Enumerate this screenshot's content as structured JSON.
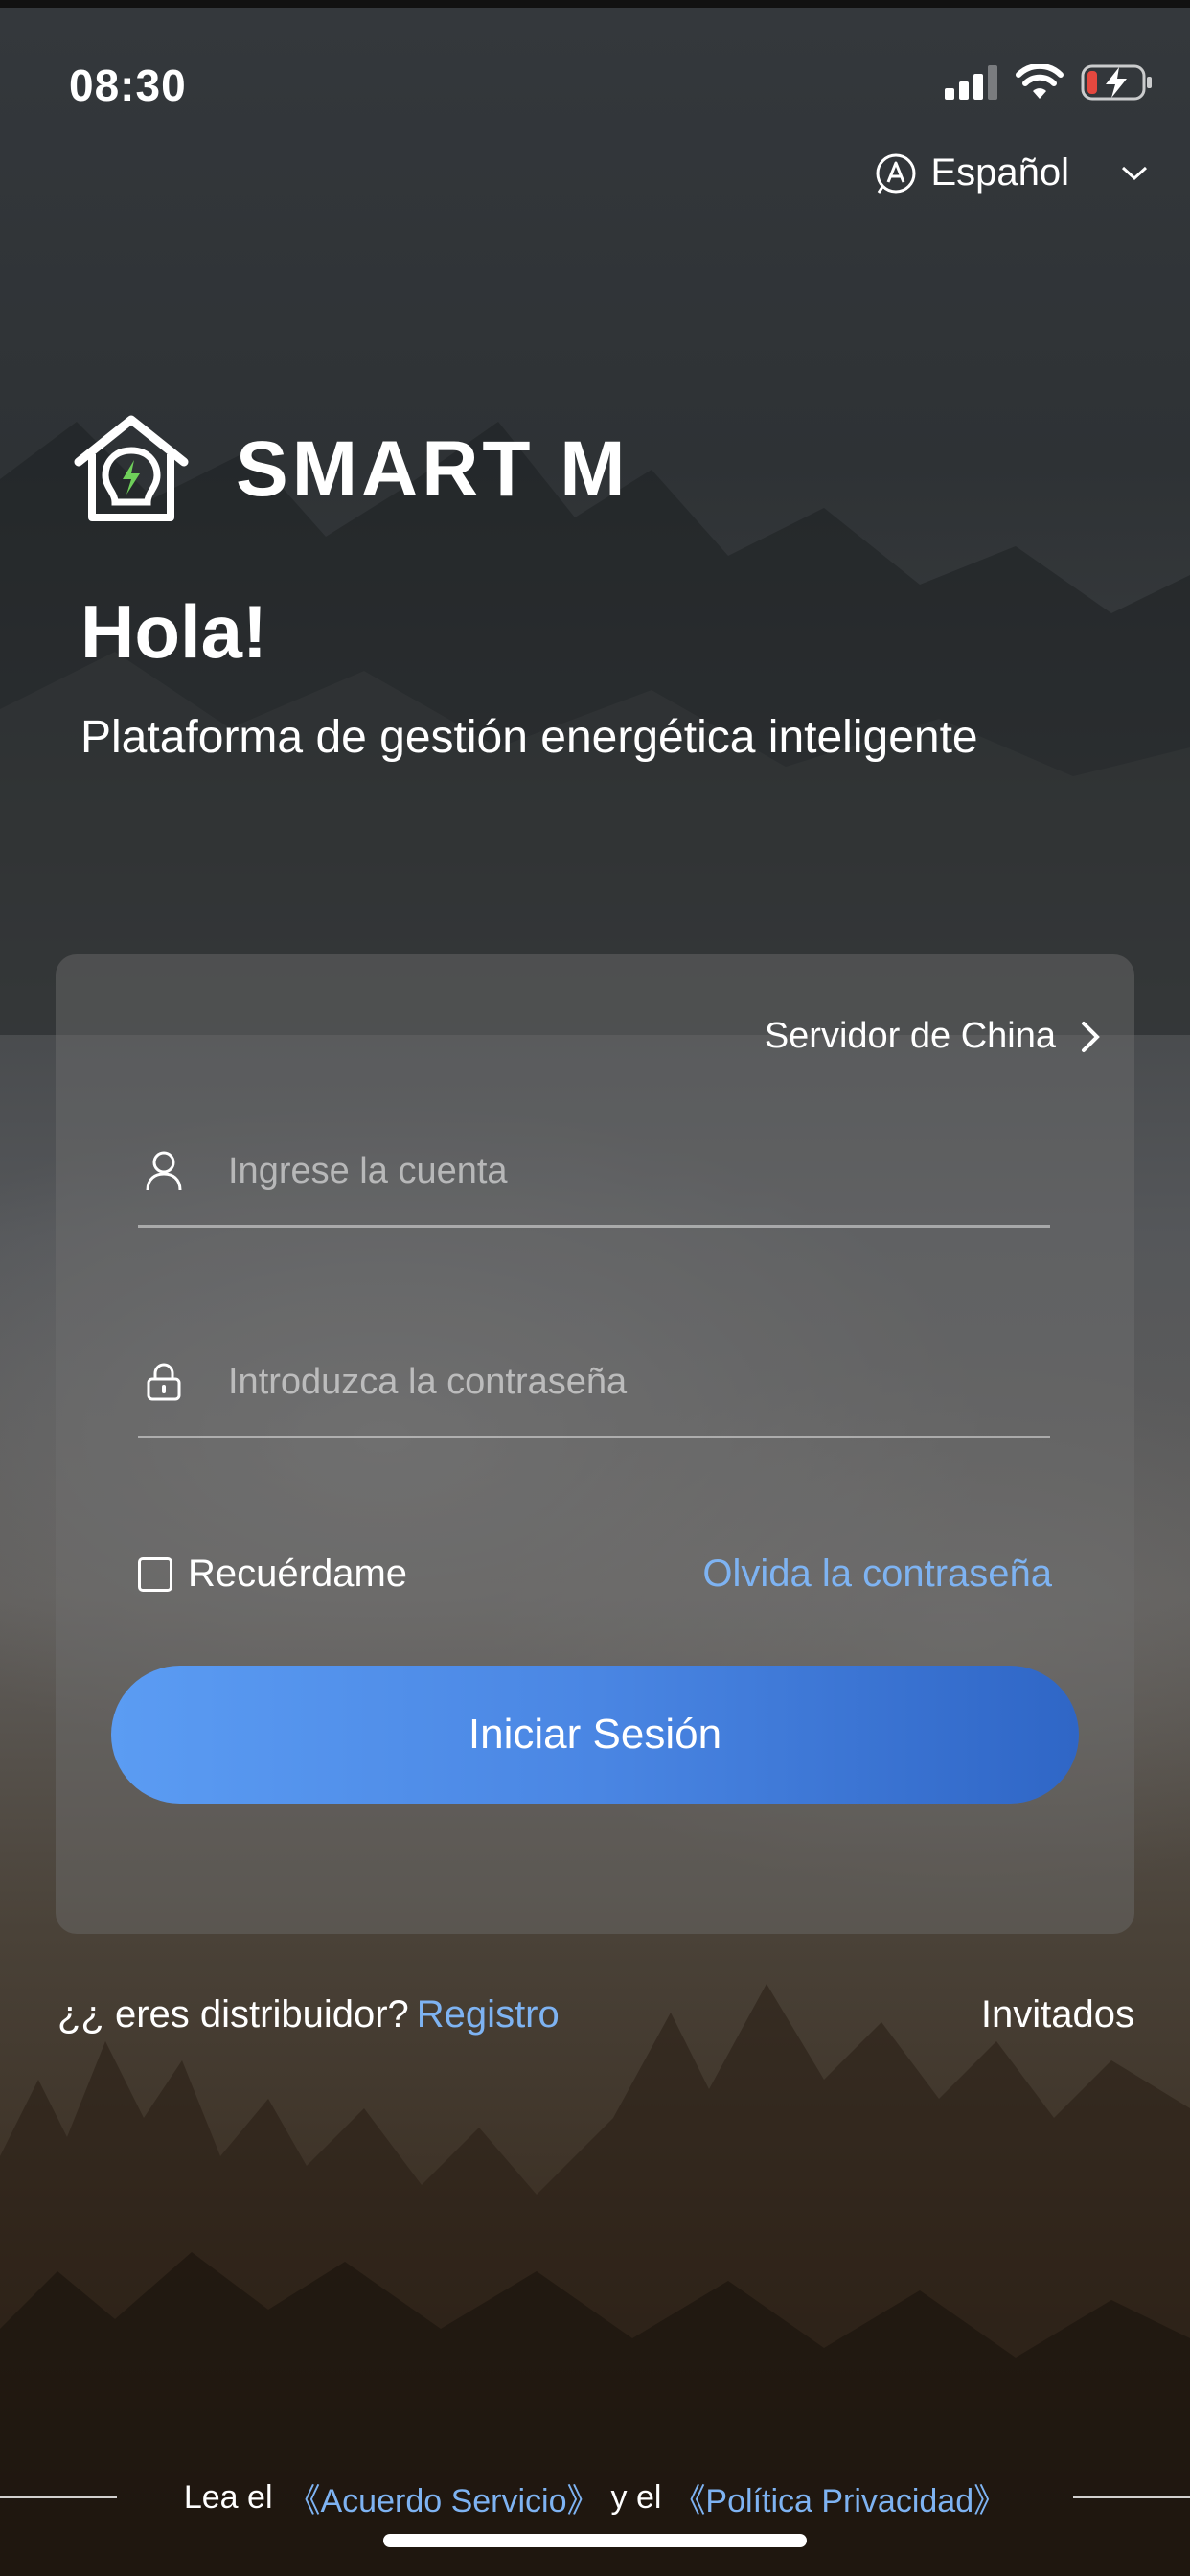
{
  "status_bar": {
    "time": "08:30"
  },
  "language": {
    "label": "Español"
  },
  "brand": {
    "name": "SMART M"
  },
  "greeting": {
    "title": "Hola!",
    "subtitle": "Plataforma de gestión energética inteligente"
  },
  "login_card": {
    "server_label": "Servidor de China",
    "account_placeholder": "Ingrese la cuenta",
    "account_value": "",
    "password_placeholder": "Introduzca la contraseña",
    "password_value": "",
    "remember_label": "Recuérdame",
    "remember_checked": false,
    "forgot_label": "Olvida la contraseña",
    "login_label": "Iniciar Sesión"
  },
  "footer": {
    "distributor_question": "¿¿ eres distribuidor?",
    "register_label": "Registro",
    "guests_label": "Invitados",
    "legal_prefix": "Lea el",
    "service_agreement": "《Acuerdo Servicio》",
    "legal_join": "y el",
    "privacy_policy": "《Política Privacidad》"
  },
  "colors": {
    "link": "#7eb3f2",
    "button_start": "#5b9cf3",
    "button_end": "#2f66c6",
    "battery_low": "#e5483f"
  },
  "icons": [
    "signal-icon",
    "wifi-icon",
    "battery-charging-icon",
    "language-icon",
    "chevron-down-icon",
    "smart-home-logo-icon",
    "chevron-right-icon",
    "user-icon",
    "lock-icon"
  ]
}
